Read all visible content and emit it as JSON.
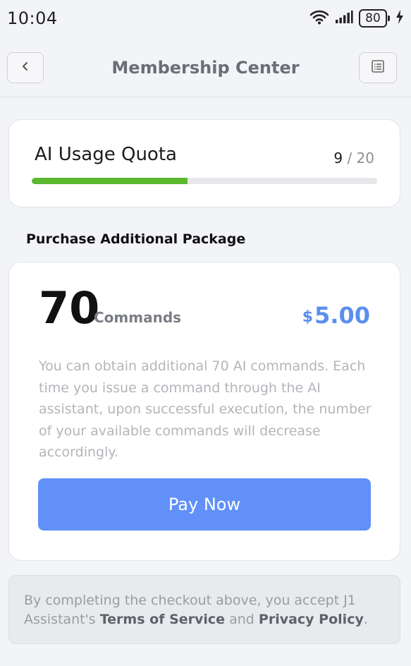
{
  "status_bar": {
    "time": "10:04",
    "battery": "80",
    "icons": [
      "wifi-icon",
      "signal-icon",
      "battery-icon",
      "charging-icon"
    ]
  },
  "nav": {
    "title": "Membership Center",
    "back_icon": "chevron-left-icon",
    "menu_icon": "list-icon"
  },
  "quota": {
    "title": "AI Usage Quota",
    "used": "9",
    "separator": "/",
    "total": "20",
    "progress_fraction": 0.45,
    "bar_color": "#5cb82f"
  },
  "section": {
    "heading": "Purchase Additional Package"
  },
  "package": {
    "count": "70",
    "unit": "Commands",
    "currency": "$",
    "price": "5.00",
    "description": "You can obtain additional 70 AI commands. Each time you issue a command through the AI assistant, upon successful execution, the number of your available commands will decrease accordingly.",
    "pay_label": "Pay Now",
    "accent_color": "#6190f9"
  },
  "terms": {
    "prefix": "By completing the checkout above, you accept J1 Assistant's ",
    "tos": "Terms of Service",
    "and": " and ",
    "privacy": "Privacy Policy",
    "suffix": "."
  }
}
